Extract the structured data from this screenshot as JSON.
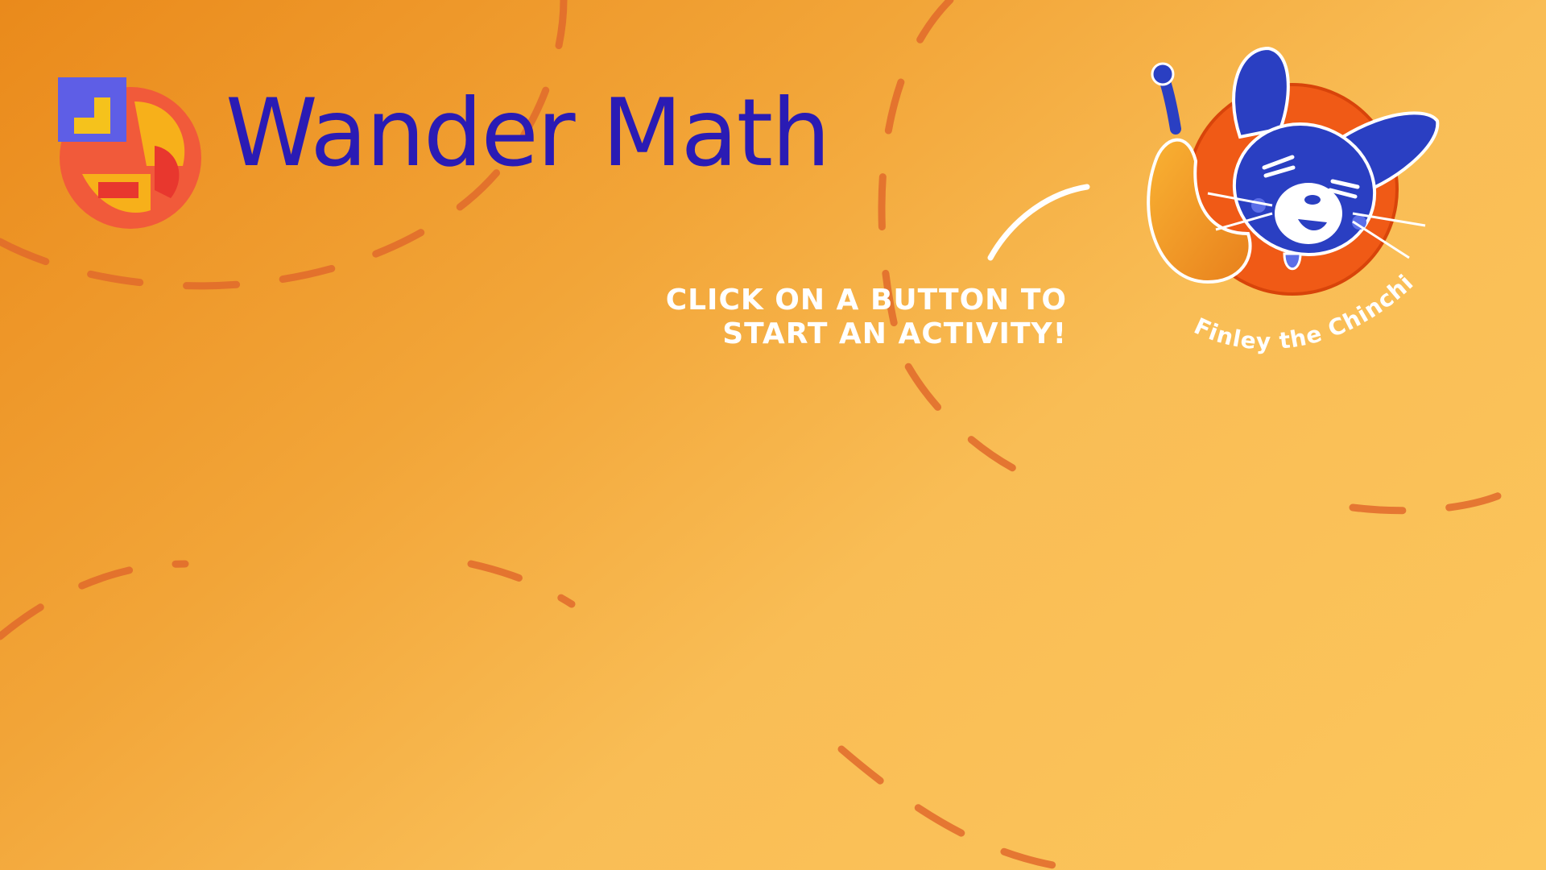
{
  "brand": {
    "name": "Wander Math",
    "logo_icon": "wander-math-logo-icon"
  },
  "instruction": {
    "text": "Click on a button to start an activity!"
  },
  "mascot": {
    "caption": "Finley the Chinchilla",
    "icon": "chinchilla-mascot-icon"
  },
  "colors": {
    "background_start": "#ea8a1b",
    "background_end": "#fcc65c",
    "brand_text": "#2a1bb4",
    "mascot_circle": "#f05a16",
    "mascot_body": "#2a3fc2",
    "decor_path": "#e06a2c",
    "instruction_text": "#ffffff"
  }
}
